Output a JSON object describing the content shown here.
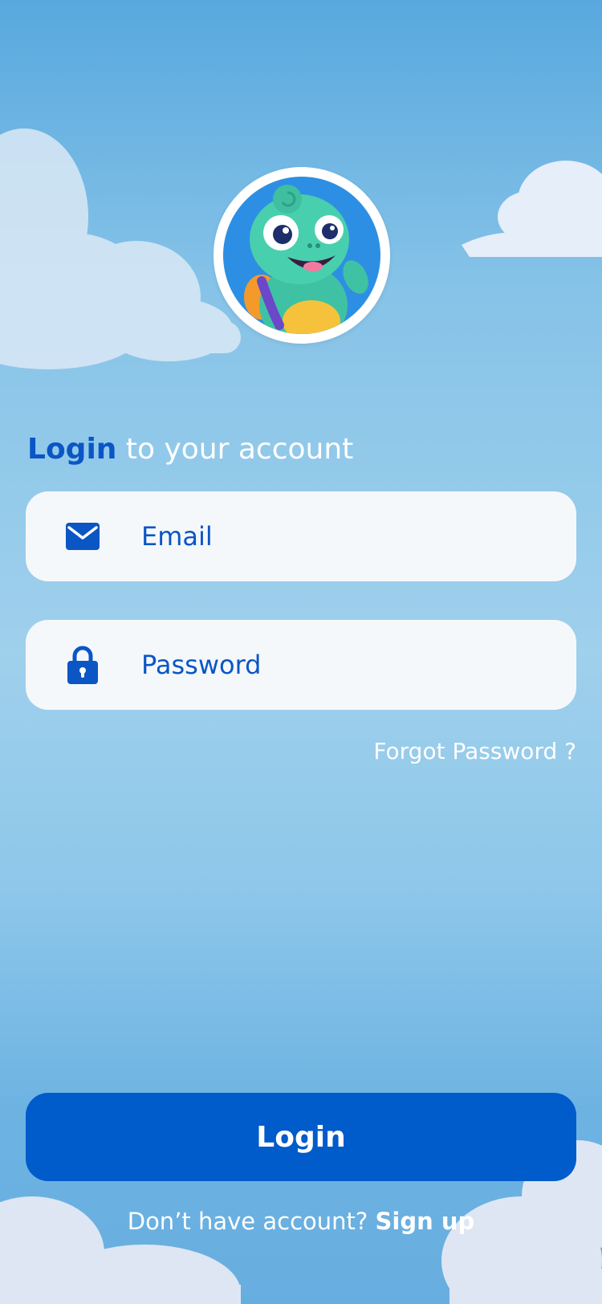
{
  "heading": {
    "emphasis": "Login",
    "rest": " to your account"
  },
  "email": {
    "icon": "mail-icon",
    "placeholder": "Email",
    "value": ""
  },
  "password": {
    "icon": "lock-icon",
    "placeholder": "Password",
    "value": ""
  },
  "forgot_password": "Forgot Password ?",
  "login_button": "Login",
  "signup": {
    "prompt": "Don’t have account? ",
    "link": "Sign up"
  },
  "colors": {
    "accent": "#0a56c5",
    "button": "#005bcb",
    "field_bg": "#f5f8fb",
    "sky_top": "#58a8de",
    "sky_mid": "#9fd0ec"
  },
  "mascot": {
    "icon": "chameleon-mascot-icon"
  }
}
